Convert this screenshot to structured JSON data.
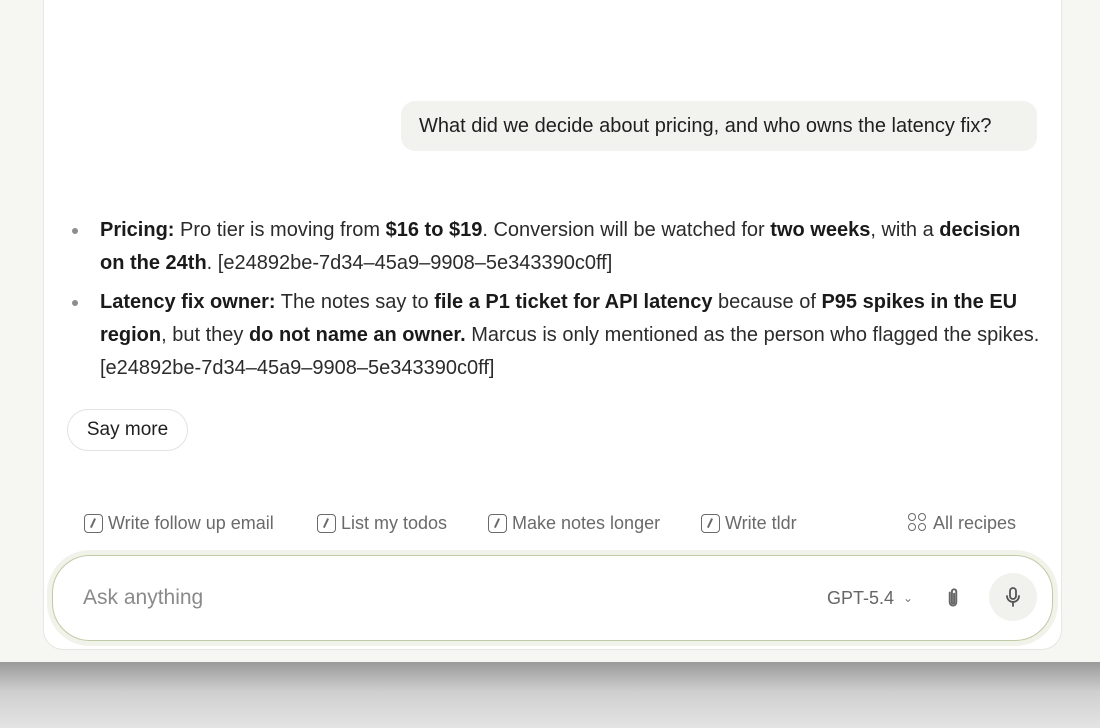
{
  "conversation": {
    "user_message": "What did we decide about pricing, and who owns the latency fix?",
    "answer": {
      "pricing": {
        "label": "Pricing:",
        "t1": " Pro tier is moving from ",
        "b1": "$16 to $19",
        "t2": ". Conversion will be watched for ",
        "b2": "two weeks",
        "t3": ", with a ",
        "b3": "decision on the 24th",
        "t4": ". [e24892be-7d34–45a9–9908–5e343390c0ff]"
      },
      "latency": {
        "label": "Latency fix owner:",
        "t1": " The notes say to ",
        "b1": "file a P1 ticket for API latency",
        "t2": " because of ",
        "b2": "P95 spikes in the EU region",
        "t3": ", but they ",
        "b3": "do not name an owner.",
        "t4": " Marcus is only mentioned as the person who flagged the spikes. [e24892be-7d34–45a9–9908–5e343390c0ff]"
      }
    },
    "say_more_label": "Say more"
  },
  "recipes": {
    "items": [
      {
        "label": "Write follow up email",
        "icon": "slash-box-icon"
      },
      {
        "label": "List my todos",
        "icon": "slash-box-icon"
      },
      {
        "label": "Make notes longer",
        "icon": "slash-box-icon"
      },
      {
        "label": "Write tldr",
        "icon": "slash-box-icon"
      }
    ],
    "all_label": "All recipes"
  },
  "composer": {
    "placeholder": "Ask anything",
    "model": "GPT-5.4"
  },
  "colors": {
    "input_border": "#bfcaa6",
    "bubble_bg": "#f2f2ef",
    "muted_text": "#6a6a6a"
  }
}
